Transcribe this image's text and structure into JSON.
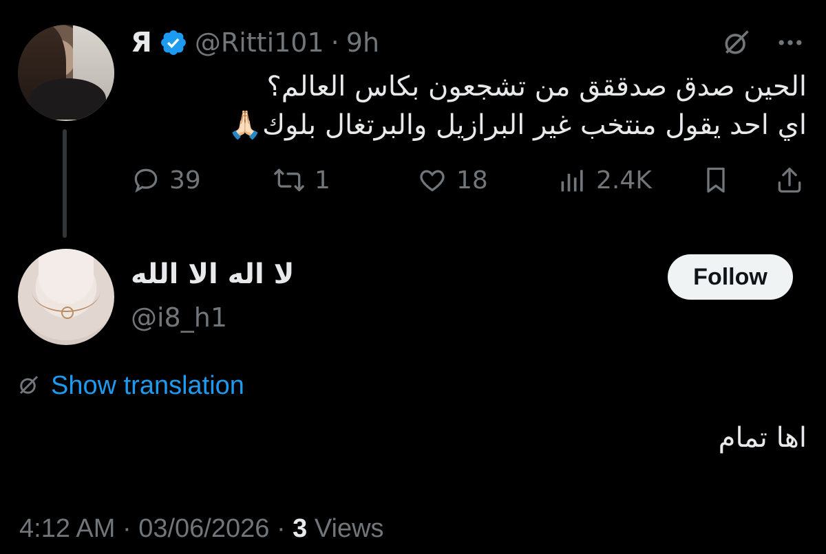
{
  "parent_tweet": {
    "display_name": "Я",
    "handle": "@Ritti101",
    "separator": "·",
    "time": "9h",
    "text_line1": "الحين صدق صدققق من تشجعون بكاس العالم؟",
    "text_line2": "اي احد يقول منتخب غير البرازيل والبرتغال بلوك🙏🏻",
    "replies": "39",
    "reposts": "1",
    "likes": "18",
    "views": "2.4K"
  },
  "reply": {
    "display_name": "لا اله الا الله",
    "handle": "@i8_h1",
    "follow_label": "Follow",
    "show_translation_label": "Show translation",
    "text": "اها تمام"
  },
  "meta": {
    "time": "4:12 AM",
    "separator1": "·",
    "date": "03/06/2026",
    "separator2": "·",
    "views_count": "3",
    "views_label": "Views"
  },
  "colors": {
    "background": "#000000",
    "text_primary": "#e7e9ea",
    "text_secondary": "#71767b",
    "accent_blue": "#1d9bf0",
    "follow_bg": "#eff3f4"
  },
  "icons": {
    "verified": "verified-badge-icon",
    "grok": "grok-icon",
    "more": "more-icon",
    "reply": "reply-icon",
    "repost": "repost-icon",
    "like": "heart-icon",
    "views": "views-icon",
    "bookmark": "bookmark-icon",
    "share": "share-icon",
    "translate": "translate-icon"
  }
}
